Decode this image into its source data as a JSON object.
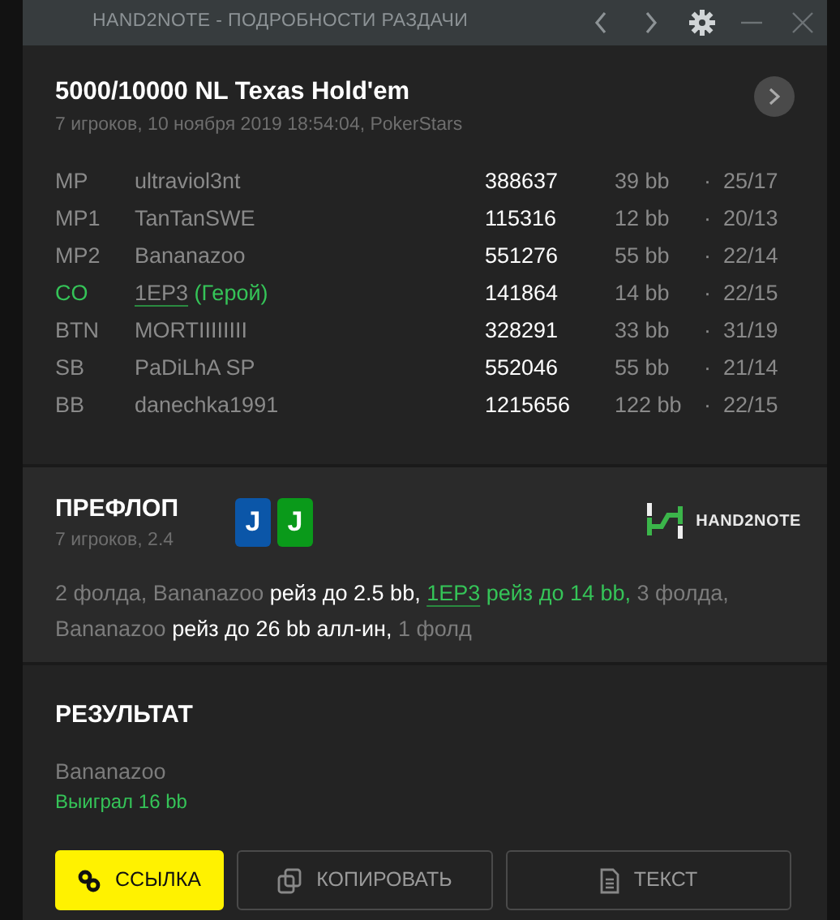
{
  "window": {
    "title": "HAND2NOTE - ПОДРОБНОСТИ РАЗДАЧИ"
  },
  "hand": {
    "title": "5000/10000 NL Texas Hold'em",
    "subtitle": "7 игроков, 10 ноября 2019 18:54:04, PokerStars"
  },
  "players": [
    {
      "position": "MP",
      "name": "ultraviol3nt",
      "hero": false,
      "stack": "388637",
      "bb": "39 bb",
      "dot": "·",
      "stats": "25/17"
    },
    {
      "position": "MP1",
      "name": "TanTanSWE",
      "hero": false,
      "stack": "115316",
      "bb": "12 bb",
      "dot": "·",
      "stats": "20/13"
    },
    {
      "position": "MP2",
      "name": "Bananazoo",
      "hero": false,
      "stack": "551276",
      "bb": "55 bb",
      "dot": "·",
      "stats": "22/14"
    },
    {
      "position": "CO",
      "name": "1EP3",
      "hero_tag": "(Герой)",
      "hero": true,
      "stack": "141864",
      "bb": "14 bb",
      "dot": "·",
      "stats": "22/15"
    },
    {
      "position": "BTN",
      "name": "MORTIIIIIIII",
      "hero": false,
      "stack": "328291",
      "bb": "33 bb",
      "dot": "·",
      "stats": "31/19"
    },
    {
      "position": "SB",
      "name": "PaDiLhA SP",
      "hero": false,
      "stack": "552046",
      "bb": "55 bb",
      "dot": "·",
      "stats": "21/14"
    },
    {
      "position": "BB",
      "name": "danechka1991",
      "hero": false,
      "stack": "1215656",
      "bb": "122 bb",
      "dot": "·",
      "stats": "22/15"
    }
  ],
  "preflop": {
    "title": "ПРЕФЛОП",
    "subtitle": "7 игроков, 2.4",
    "cards": [
      {
        "rank": "J",
        "color": "#0b56a8"
      },
      {
        "rank": "J",
        "color": "#0a9a1a"
      }
    ],
    "logo": {
      "text": "HAND2NOTE"
    },
    "actions": [
      {
        "kind": "plain",
        "text": "2 фолда, Bananazoo "
      },
      {
        "kind": "bold",
        "text": "рейз до 2.5 bb, "
      },
      {
        "kind": "hero-link",
        "text": "1EP3"
      },
      {
        "kind": "hero",
        "text": " рейз до 14 bb,"
      },
      {
        "kind": "plain",
        "text": " 3 фолда, Bananazoo "
      },
      {
        "kind": "bold",
        "text": "рейз до 26 bb алл-ин,"
      },
      {
        "kind": "plain",
        "text": " 1 фолд"
      }
    ]
  },
  "result": {
    "title": "РЕЗУЛЬТАТ",
    "winner": "Bananazoo",
    "won": "Выиграл 16 bb"
  },
  "buttons": [
    {
      "label": "ССЫЛКА",
      "kind": "link",
      "primary": true
    },
    {
      "label": "КОПИРОВАТЬ",
      "kind": "copy",
      "primary": false
    },
    {
      "label": "ТЕКСТ",
      "kind": "text",
      "primary": false
    }
  ]
}
